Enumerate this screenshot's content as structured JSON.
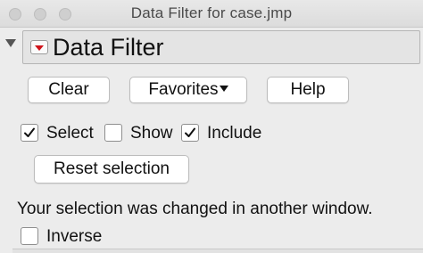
{
  "window": {
    "title": "Data Filter for case.jmp"
  },
  "header": {
    "label": "Data Filter",
    "menu_icon": "red-triangle-icon",
    "disclosure_icon": "disclosure-triangle-icon",
    "accent": "#d0141b"
  },
  "buttons": {
    "clear": "Clear",
    "favorites": "Favorites",
    "help": "Help",
    "reset": "Reset selection"
  },
  "checkboxes": {
    "select": {
      "label": "Select",
      "checked": true
    },
    "show": {
      "label": "Show",
      "checked": false
    },
    "include": {
      "label": "Include",
      "checked": true
    },
    "inverse": {
      "label": "Inverse",
      "checked": false
    }
  },
  "message": "Your selection was changed in another window."
}
